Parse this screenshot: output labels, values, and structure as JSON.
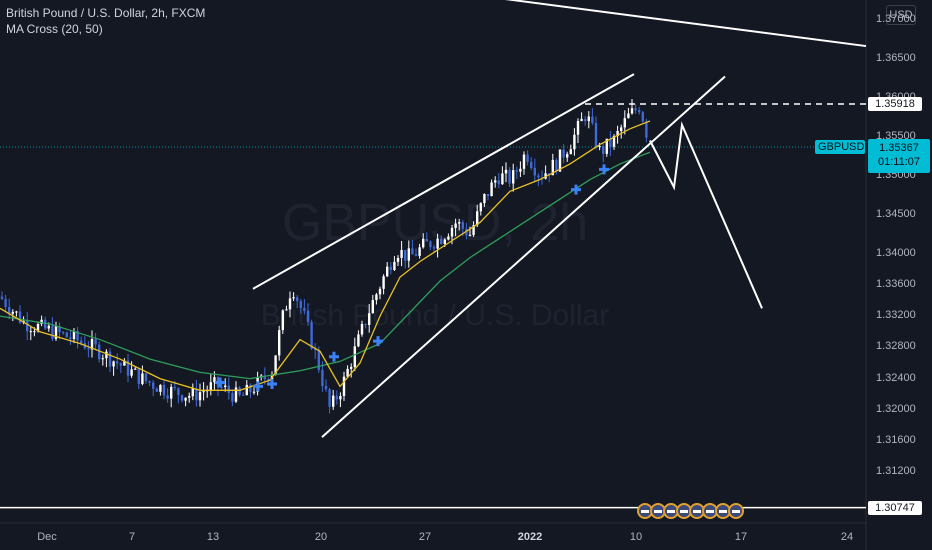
{
  "header": {
    "title": "British Pound / U.S. Dollar, 2h, FXCM",
    "indicator": "MA Cross (20, 50)"
  },
  "watermark": {
    "symbol": "GBPUSD, 2h",
    "name": "British Pound / U.S. Dollar"
  },
  "currency_button": "USD",
  "price_tags": {
    "level_upper": "1.35918",
    "level_lower": "1.30747",
    "symbol": "GBPUSD",
    "current_price": "1.35367",
    "countdown": "01:11:07"
  },
  "colors": {
    "background": "#141823",
    "candle_up": "#ffffff",
    "candle_down": "#3f69d6",
    "ma_fast": "#e8c025",
    "ma_slow": "#2f9e5a",
    "cross_marker": "#3b82f6",
    "drawing": "#ffffff",
    "price_line": "#00bcd4"
  },
  "chart_data": {
    "type": "candlestick",
    "y_axis": {
      "ticks": [
        "1.37000",
        "1.36500",
        "1.36000",
        "1.35500",
        "1.35000",
        "1.34500",
        "1.34000",
        "1.33600",
        "1.33200",
        "1.32800",
        "1.32400",
        "1.32000",
        "1.31600",
        "1.31200"
      ],
      "range": [
        1.3055,
        1.3725
      ]
    },
    "x_axis": {
      "ticks": [
        {
          "label": "Dec",
          "bold": false
        },
        {
          "label": "7",
          "bold": false
        },
        {
          "label": "13",
          "bold": false
        },
        {
          "label": "20",
          "bold": false
        },
        {
          "label": "27",
          "bold": false
        },
        {
          "label": "2022",
          "bold": true
        },
        {
          "label": "10",
          "bold": false
        },
        {
          "label": "17",
          "bold": false
        },
        {
          "label": "24",
          "bold": false
        }
      ]
    },
    "price_path": [
      [
        0,
        1.3345
      ],
      [
        24,
        1.3312
      ],
      [
        48,
        1.3302
      ],
      [
        72,
        1.3292
      ],
      [
        96,
        1.3278
      ],
      [
        120,
        1.3258
      ],
      [
        144,
        1.3238
      ],
      [
        168,
        1.3225
      ],
      [
        192,
        1.3218
      ],
      [
        216,
        1.3232
      ],
      [
        240,
        1.3215
      ],
      [
        260,
        1.3235
      ],
      [
        272,
        1.325
      ],
      [
        282,
        1.3315
      ],
      [
        292,
        1.336
      ],
      [
        304,
        1.332
      ],
      [
        318,
        1.326
      ],
      [
        330,
        1.32
      ],
      [
        342,
        1.323
      ],
      [
        356,
        1.328
      ],
      [
        370,
        1.333
      ],
      [
        382,
        1.3365
      ],
      [
        396,
        1.3405
      ],
      [
        410,
        1.3395
      ],
      [
        424,
        1.341
      ],
      [
        440,
        1.342
      ],
      [
        456,
        1.344
      ],
      [
        470,
        1.3425
      ],
      [
        484,
        1.347
      ],
      [
        498,
        1.35
      ],
      [
        512,
        1.3495
      ],
      [
        526,
        1.353
      ],
      [
        540,
        1.35
      ],
      [
        556,
        1.3515
      ],
      [
        572,
        1.3545
      ],
      [
        586,
        1.358
      ],
      [
        600,
        1.353
      ],
      [
        614,
        1.3545
      ],
      [
        628,
        1.3575
      ],
      [
        640,
        1.359
      ],
      [
        650,
        1.3537
      ]
    ],
    "ma_fast": [
      [
        0,
        1.333
      ],
      [
        40,
        1.33
      ],
      [
        80,
        1.3285
      ],
      [
        120,
        1.3265
      ],
      [
        160,
        1.324
      ],
      [
        200,
        1.3225
      ],
      [
        240,
        1.3225
      ],
      [
        270,
        1.3238
      ],
      [
        300,
        1.329
      ],
      [
        320,
        1.3275
      ],
      [
        340,
        1.323
      ],
      [
        360,
        1.326
      ],
      [
        380,
        1.332
      ],
      [
        400,
        1.337
      ],
      [
        420,
        1.339
      ],
      [
        450,
        1.3415
      ],
      [
        480,
        1.344
      ],
      [
        510,
        1.348
      ],
      [
        540,
        1.3495
      ],
      [
        570,
        1.3515
      ],
      [
        600,
        1.354
      ],
      [
        630,
        1.356
      ],
      [
        650,
        1.357
      ]
    ],
    "ma_slow": [
      [
        0,
        1.332
      ],
      [
        50,
        1.331
      ],
      [
        100,
        1.329
      ],
      [
        150,
        1.3265
      ],
      [
        200,
        1.3248
      ],
      [
        250,
        1.324
      ],
      [
        300,
        1.325
      ],
      [
        340,
        1.3262
      ],
      [
        380,
        1.3285
      ],
      [
        410,
        1.3325
      ],
      [
        440,
        1.3365
      ],
      [
        470,
        1.3395
      ],
      [
        500,
        1.342
      ],
      [
        530,
        1.3445
      ],
      [
        560,
        1.347
      ],
      [
        590,
        1.3495
      ],
      [
        620,
        1.3515
      ],
      [
        650,
        1.353
      ]
    ],
    "cross_points": [
      [
        220,
        1.3235
      ],
      [
        258,
        1.323
      ],
      [
        272,
        1.3233
      ],
      [
        334,
        1.3268
      ],
      [
        378,
        1.3288
      ],
      [
        576,
        1.3482
      ],
      [
        604,
        1.3508
      ]
    ],
    "drawings": {
      "channel_upper": [
        [
          253,
          1.3355
        ],
        [
          634,
          1.363
        ]
      ],
      "channel_lower": [
        [
          322,
          1.3165
        ],
        [
          725,
          1.3627
        ]
      ],
      "trend_top": [
        [
          213,
          1.3775
        ],
        [
          866,
          1.3666
        ]
      ],
      "projection": [
        [
          650,
          1.3545
        ],
        [
          674,
          1.3485
        ],
        [
          682,
          1.3565
        ],
        [
          762,
          1.333
        ]
      ],
      "level_dashed": 1.35918,
      "level_solid": 1.30747
    }
  }
}
